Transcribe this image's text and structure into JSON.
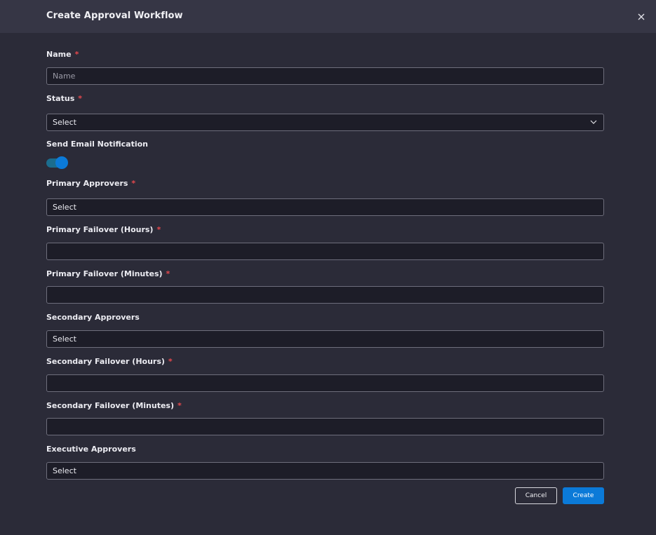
{
  "dialog": {
    "title": "Create Approval Workflow",
    "close_icon": "close-icon"
  },
  "required_marker": "*",
  "fields": {
    "name": {
      "label": "Name",
      "placeholder": "Name",
      "value": ""
    },
    "status": {
      "label": "Status",
      "value": "Select"
    },
    "send_email": {
      "label": "Send Email Notification",
      "enabled": true
    },
    "primary_approvers": {
      "label": "Primary Approvers",
      "value": "Select"
    },
    "primary_failover_hours": {
      "label": "Primary Failover (Hours)",
      "value": ""
    },
    "primary_failover_minutes": {
      "label": "Primary Failover (Minutes)",
      "value": ""
    },
    "secondary_approvers": {
      "label": "Secondary Approvers",
      "value": "Select"
    },
    "secondary_failover_hours": {
      "label": "Secondary Failover (Hours)",
      "value": ""
    },
    "secondary_failover_minutes": {
      "label": "Secondary Failover (Minutes)",
      "value": ""
    },
    "executive_approvers": {
      "label": "Executive Approvers",
      "value": "Select"
    }
  },
  "actions": {
    "cancel_label": "Cancel",
    "create_label": "Create"
  },
  "colors": {
    "background": "#2b2b38",
    "header": "#363645",
    "input_background": "#1d1d28",
    "input_border": "#6e6e7c",
    "required": "#e5484d",
    "accent": "#0b7ad8",
    "toggle_track": "#1b6d8e"
  }
}
